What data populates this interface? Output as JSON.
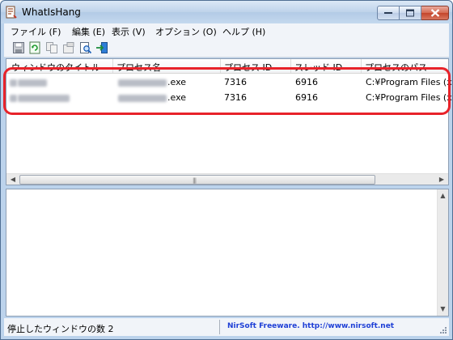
{
  "window": {
    "title": "WhatIsHang",
    "icon": "app-icon"
  },
  "menu": [
    {
      "label": "ファイル (F)"
    },
    {
      "label": "編集 (E)"
    },
    {
      "label": "表示 (V)"
    },
    {
      "label": "オプション (O)"
    },
    {
      "label": "ヘルプ (H)"
    }
  ],
  "toolbar": {
    "icons": [
      "save-icon",
      "refresh-icon",
      "copy-icon",
      "properties-icon",
      "find-icon",
      "exit-icon"
    ]
  },
  "list": {
    "columns": [
      "ウィンドウのタイトル",
      "プロセス名",
      "プロセス ID",
      "スレッド ID",
      "プロセスのパス"
    ],
    "rows": [
      {
        "process_suffix": ".exe",
        "process_id": "7316",
        "thread_id": "6916",
        "path": "C:¥Program Files (x"
      },
      {
        "process_suffix": ".exe",
        "process_id": "7316",
        "thread_id": "6916",
        "path": "C:¥Program Files (x"
      }
    ]
  },
  "status": {
    "left": "停止したウィンドウの数 2",
    "right": "NirSoft Freeware.  http://www.nirsoft.net"
  },
  "colors": {
    "highlight": "#e8232a",
    "link": "#1e3fd6"
  }
}
